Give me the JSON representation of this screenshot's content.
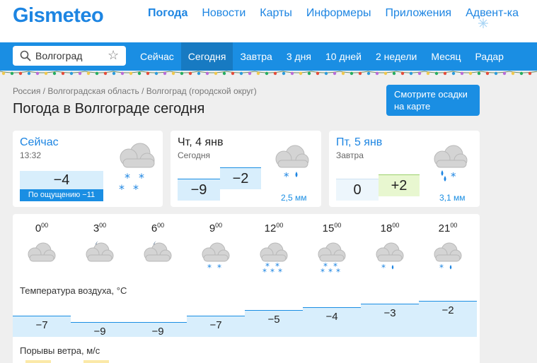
{
  "logo": "Gismeteo",
  "top_nav": [
    "Погода",
    "Новости",
    "Карты",
    "Информеры",
    "Приложения",
    "Адвент-ка"
  ],
  "search": {
    "value": "Волгоград"
  },
  "blue_nav": [
    "Сейчас",
    "Сегодня",
    "Завтра",
    "3 дня",
    "10 дней",
    "2 недели",
    "Месяц",
    "Радар"
  ],
  "breadcrumb": "Россия / Волгоградская область / Волгоград (городской округ)",
  "page_title": "Погода в Волгограде сегодня",
  "map_button": {
    "line1": "Смотрите осадки",
    "line2": "на карте"
  },
  "now": {
    "label": "Сейчас",
    "time": "13:32",
    "temp": "−4",
    "feels": "По ощущению −11"
  },
  "today": {
    "label": "Чт, 4 янв",
    "sub": "Сегодня",
    "t_min": "−9",
    "t_max": "−2",
    "precip": "2,5 мм"
  },
  "tomorrow": {
    "label": "Пт, 5 янв",
    "sub": "Завтра",
    "t_min": "0",
    "t_max": "+2",
    "precip": "3,1 мм"
  },
  "hourly": {
    "hours": [
      {
        "h": "0",
        "m": "00"
      },
      {
        "h": "3",
        "m": "00"
      },
      {
        "h": "6",
        "m": "00"
      },
      {
        "h": "9",
        "m": "00"
      },
      {
        "h": "12",
        "m": "00"
      },
      {
        "h": "15",
        "m": "00"
      },
      {
        "h": "18",
        "m": "00"
      },
      {
        "h": "21",
        "m": "00"
      }
    ],
    "icons": [
      "cloudy-icon",
      "night-cloudy-icon",
      "night-cloudy-icon",
      "snow-icon",
      "heavy-snow-icon",
      "heavy-snow-icon",
      "sleet-icon",
      "sleet-icon"
    ],
    "temp_label": "Температура воздуха, °C",
    "temps": [
      "−7",
      "−9",
      "−9",
      "−7",
      "−5",
      "−4",
      "−3",
      "−2"
    ],
    "temp_values": [
      -7,
      -9,
      -9,
      -7,
      -5,
      -4,
      -3,
      -2
    ],
    "wind_label": "Порывы ветра, м/с"
  },
  "colors": {
    "brand": "#1d85e2",
    "bar": "#1a8ee3",
    "cold": "#d8eefc",
    "warm": "#e8f7d0"
  }
}
